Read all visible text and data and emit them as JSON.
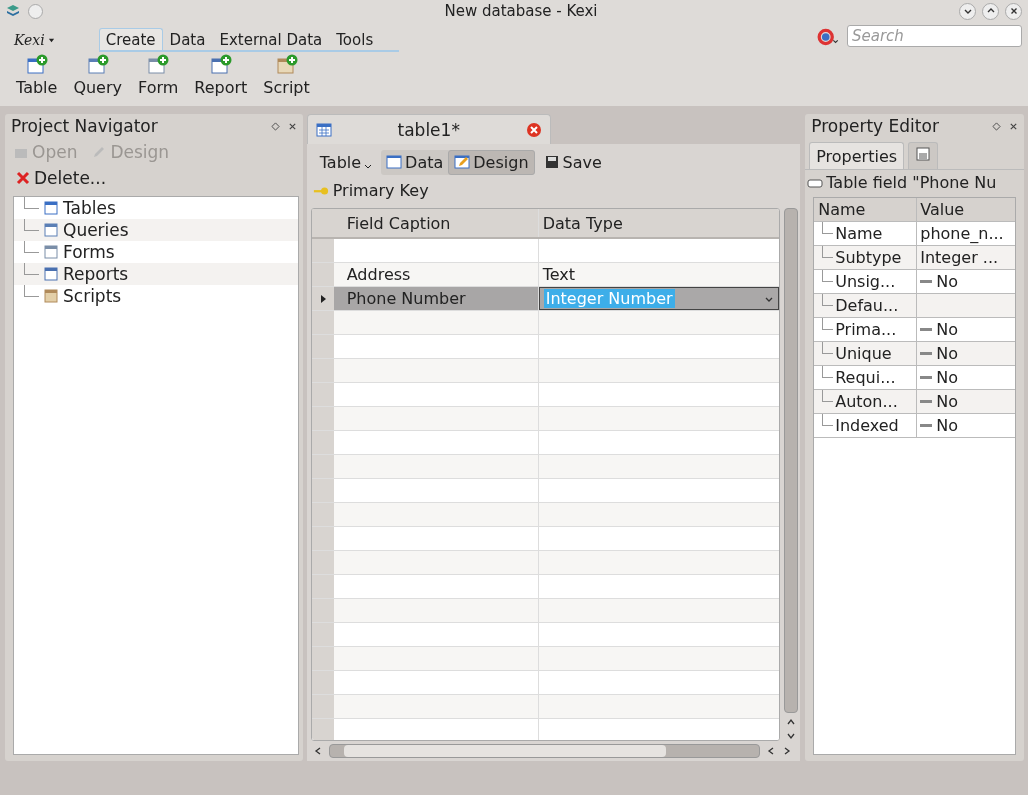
{
  "window": {
    "title": "New database - Kexi"
  },
  "app_menu": {
    "label": "Kexi"
  },
  "ribbon_tabs": [
    {
      "label": "Create",
      "selected": true
    },
    {
      "label": "Data",
      "selected": false
    },
    {
      "label": "External Data",
      "selected": false
    },
    {
      "label": "Tools",
      "selected": false
    }
  ],
  "search": {
    "placeholder": "Search"
  },
  "create_buttons": [
    {
      "label": "Table",
      "kind": "table"
    },
    {
      "label": "Query",
      "kind": "query"
    },
    {
      "label": "Form",
      "kind": "form"
    },
    {
      "label": "Report",
      "kind": "report"
    },
    {
      "label": "Script",
      "kind": "script"
    }
  ],
  "project_navigator": {
    "title": "Project Navigator",
    "actions": [
      {
        "label": "Open",
        "kind": "open",
        "disabled": true
      },
      {
        "label": "Design",
        "kind": "design",
        "disabled": true
      }
    ],
    "delete": {
      "label": "Delete..."
    },
    "items": [
      {
        "label": "Tables",
        "kind": "table"
      },
      {
        "label": "Queries",
        "kind": "query"
      },
      {
        "label": "Forms",
        "kind": "form"
      },
      {
        "label": "Reports",
        "kind": "report"
      },
      {
        "label": "Scripts",
        "kind": "script"
      }
    ]
  },
  "document_tab": {
    "title": "table1*"
  },
  "view_toolbar": {
    "menu": "Table",
    "views": [
      {
        "label": "Data",
        "kind": "data",
        "selected": false
      },
      {
        "label": "Design",
        "kind": "design",
        "selected": true
      }
    ],
    "save": "Save"
  },
  "primary_key": {
    "label": "Primary Key"
  },
  "table": {
    "columns": [
      "Field Caption",
      "Data Type"
    ],
    "rows": [
      {
        "field_caption": "Address",
        "data_type": "Text",
        "selected": false
      },
      {
        "field_caption": "Phone Number",
        "data_type": "Integer Number",
        "selected": true
      }
    ]
  },
  "property_editor": {
    "title": "Property Editor",
    "tabs": [
      {
        "label": "Properties",
        "kind": "text",
        "selected": true
      },
      {
        "kind": "icon",
        "selected": false
      }
    ],
    "subject": "Table field \"Phone Nu",
    "columns": [
      "Name",
      "Value"
    ],
    "rows": [
      {
        "name": "Name",
        "kind": "text",
        "value": "phone_n..."
      },
      {
        "name": "Subtype",
        "kind": "text",
        "value": "Integer ..."
      },
      {
        "name": "Unsig...",
        "kind": "bool",
        "value": "No"
      },
      {
        "name": "Defau...",
        "kind": "empty"
      },
      {
        "name": "Prima...",
        "kind": "bool",
        "value": "No"
      },
      {
        "name": "Unique",
        "kind": "bool",
        "value": "No"
      },
      {
        "name": "Requi...",
        "kind": "bool",
        "value": "No"
      },
      {
        "name": "Auton...",
        "kind": "bool",
        "value": "No"
      },
      {
        "name": "Indexed",
        "kind": "bool",
        "value": "No"
      }
    ]
  }
}
